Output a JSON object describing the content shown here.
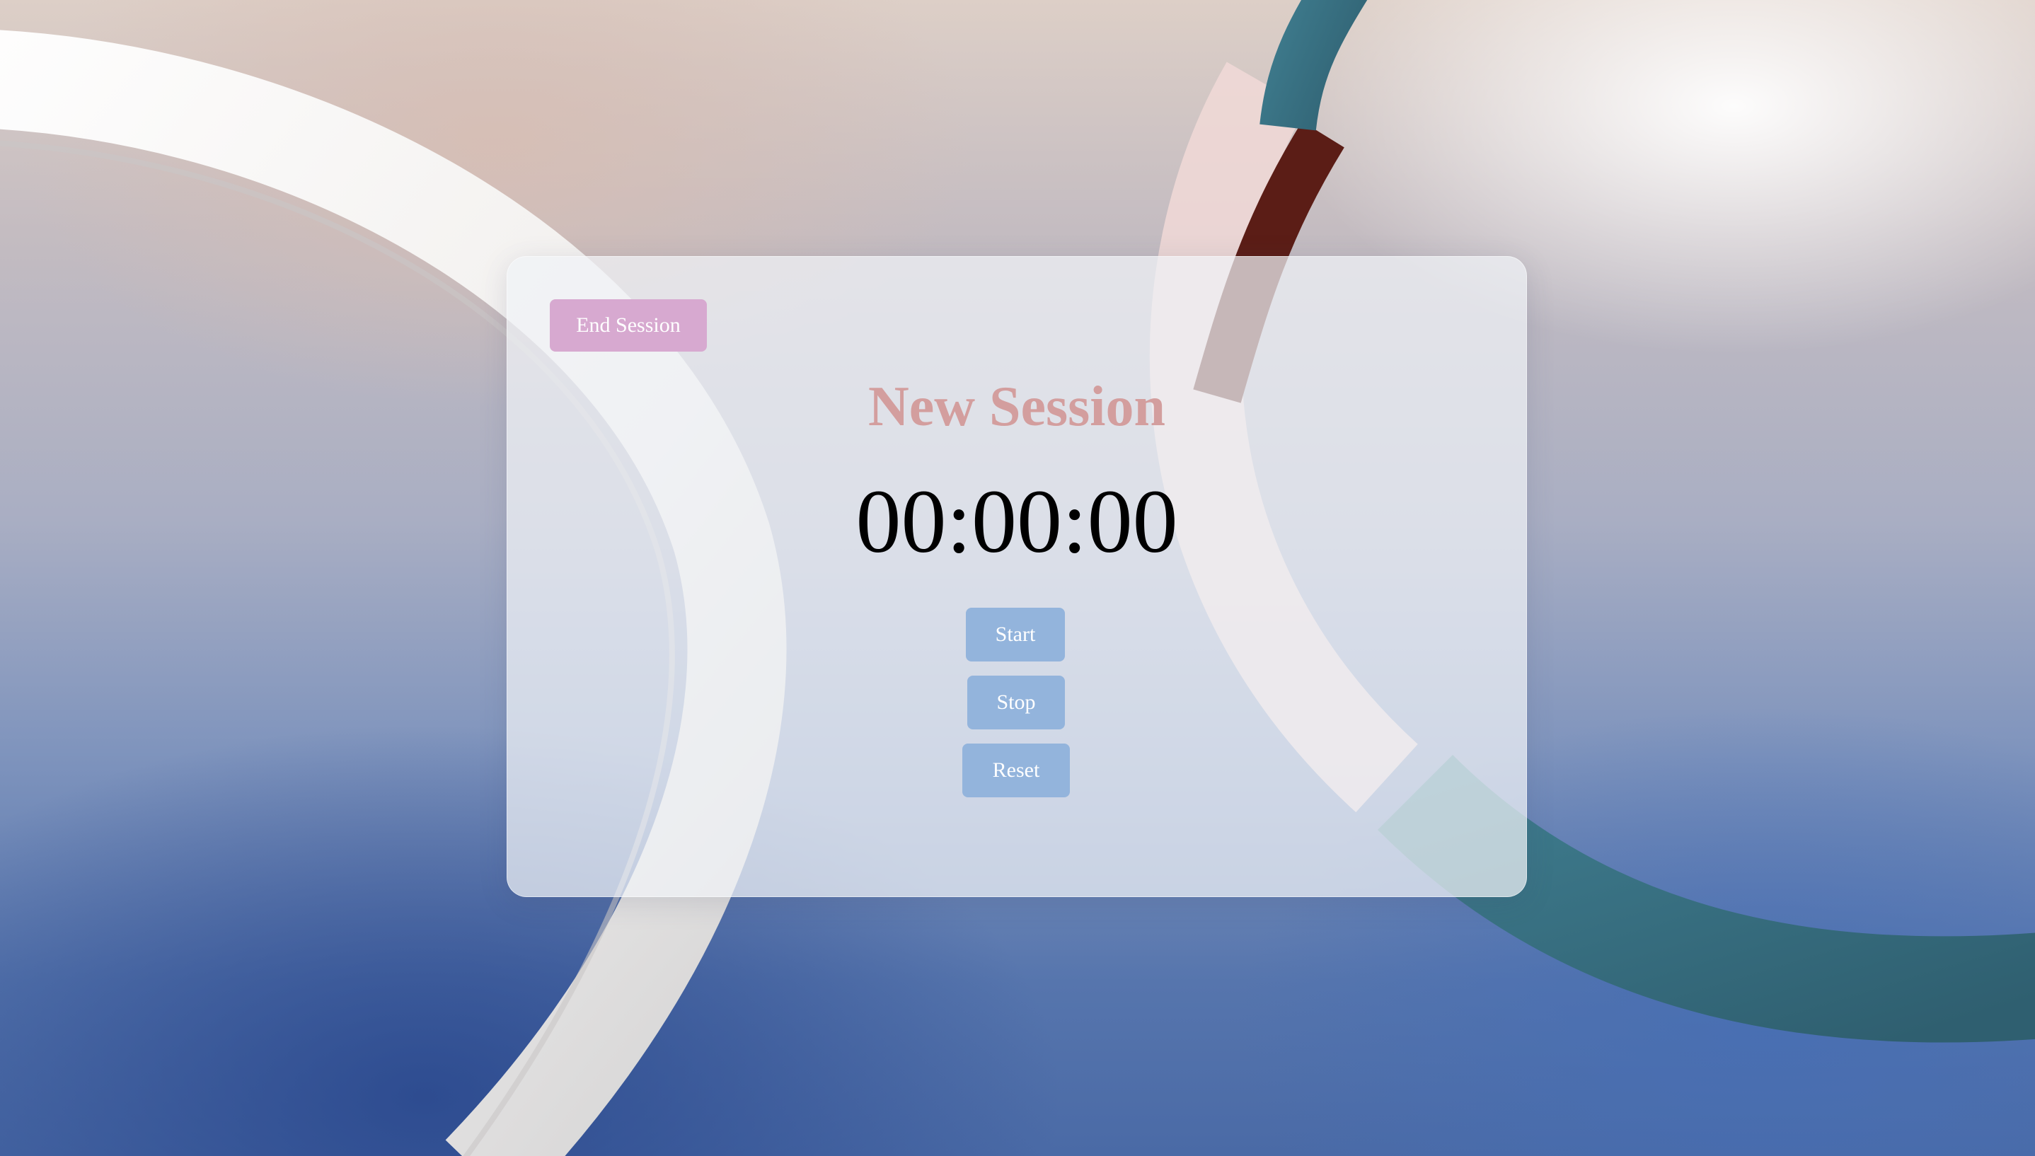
{
  "session": {
    "end_label": "End Session",
    "title": "New Session",
    "timer": "00:00:00"
  },
  "controls": {
    "start_label": "Start",
    "stop_label": "Stop",
    "reset_label": "Reset"
  },
  "colors": {
    "end_button": "#d7a9d0",
    "title": "#d39e9e",
    "action_buttons": "#93b4dc",
    "timer": "#000000"
  }
}
